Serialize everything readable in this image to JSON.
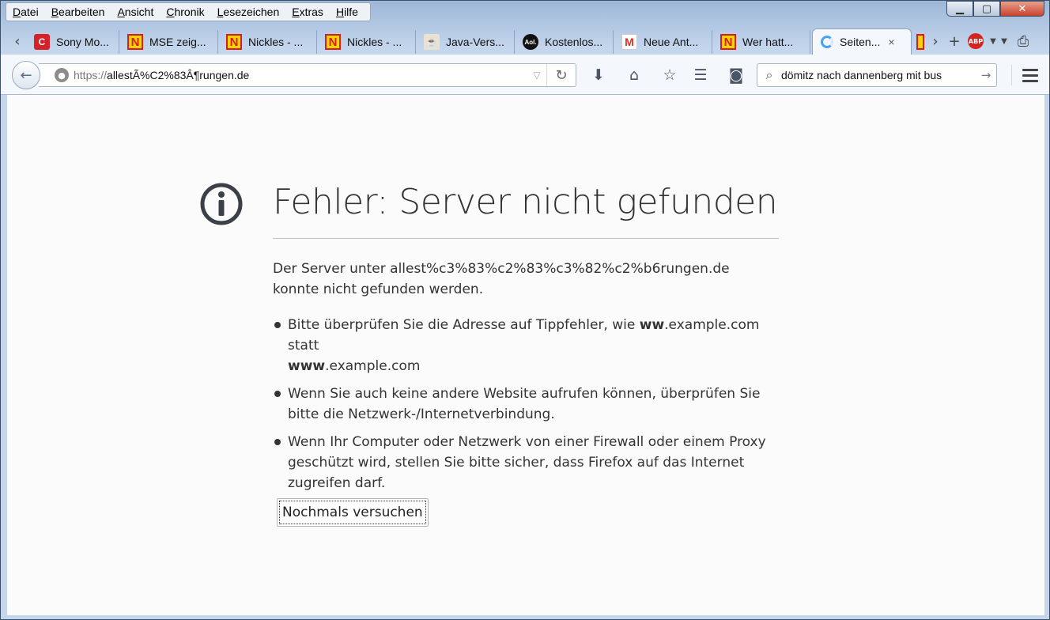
{
  "menubar": {
    "items": [
      "Datei",
      "Bearbeiten",
      "Ansicht",
      "Chronik",
      "Lesezeichen",
      "Extras",
      "Hilfe"
    ]
  },
  "tabs": [
    {
      "label": "Sony Mo...",
      "favicon": "sony-icon"
    },
    {
      "label": "MSE zeig...",
      "favicon": "nickles-icon"
    },
    {
      "label": "Nickles - ...",
      "favicon": "nickles-icon"
    },
    {
      "label": "Nickles - ...",
      "favicon": "nickles-icon"
    },
    {
      "label": "Java-Vers...",
      "favicon": "java-icon"
    },
    {
      "label": "Kostenlos...",
      "favicon": "aol-icon"
    },
    {
      "label": "Neue Ant...",
      "favicon": "gmail-icon"
    },
    {
      "label": "Wer hatt...",
      "favicon": "nickles-icon"
    },
    {
      "label": "Seiten...",
      "favicon": "loading-icon",
      "active": true
    }
  ],
  "tab_close_glyph": "×",
  "abp_label": "ABP",
  "aol_label": "Aol.",
  "urlbar": {
    "protocol": "https://",
    "host": "allestÃ%C2%83Â¶rungen.de"
  },
  "searchbar": {
    "value": "dömitz nach dannenberg mit bus"
  },
  "error": {
    "title": "Fehler: Server nicht gefunden",
    "description": "Der Server unter allest%c3%83%c2%83%c3%82%c2%b6rungen.de konnte nicht gefunden werden.",
    "tip1_pre": "Bitte überprüfen Sie die Adresse auf Tippfehler, wie ",
    "tip1_bold1": "ww",
    "tip1_mid": ".example.com statt ",
    "tip1_bold2": "www",
    "tip1_post": ".example.com",
    "tip2": "Wenn Sie auch keine andere Website aufrufen können, überprüfen Sie bitte die Netzwerk-/Internetverbindung.",
    "tip3": "Wenn Ihr Computer oder Netzwerk von einer Firewall oder einem Proxy geschützt wird, stellen Sie bitte sicher, dass Firefox auf das Internet zugreifen darf.",
    "retry_label": "Nochmals versuchen"
  },
  "colors": {
    "window_frame": "#c4d6ec",
    "content_bg": "#fbfbfb",
    "close_button": "#c8432d"
  }
}
